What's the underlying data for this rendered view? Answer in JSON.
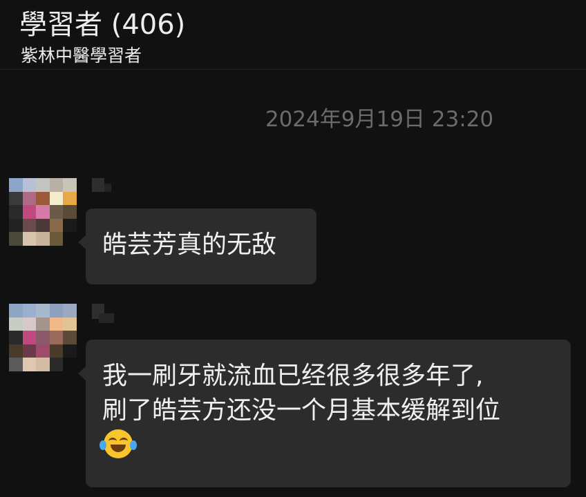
{
  "header": {
    "title": "學習者 (406)",
    "subtitle": "紫林中醫學習者"
  },
  "chat": {
    "timestamp": "2024年9月19日 23:20",
    "messages": [
      {
        "text": "皓芸芳真的无敌"
      },
      {
        "text": "我一刷牙就流血已经很多很多年了,\n刷了皓芸方还没一个月基本缓解到位",
        "emoji": "face-with-tears-of-joy-icon"
      }
    ]
  },
  "colors": {
    "background": "#111111",
    "bubble": "#2c2c2c",
    "timestamp": "#6b6b6b",
    "text": "#f0f0f0"
  }
}
